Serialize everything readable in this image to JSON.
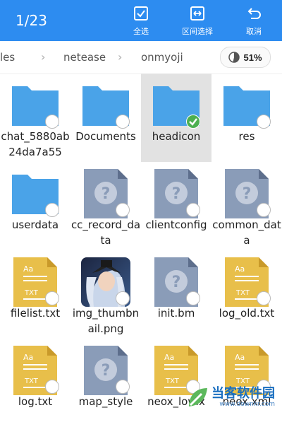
{
  "header": {
    "counter": "1/23",
    "actions": [
      {
        "label": "全选",
        "icon": "check-box-icon"
      },
      {
        "label": "区间选择",
        "icon": "range-select-icon"
      },
      {
        "label": "取消",
        "icon": "return-arrow-icon"
      }
    ],
    "background": "#2d8cf0"
  },
  "breadcrumb": {
    "items": [
      "les",
      "netease",
      "onmyoji"
    ],
    "storage": "51%"
  },
  "files": [
    {
      "name": "chat_5880ab24da7a55",
      "type": "folder",
      "selected": false
    },
    {
      "name": "Documents",
      "type": "folder",
      "selected": false
    },
    {
      "name": "headicon",
      "type": "folder",
      "selected": true
    },
    {
      "name": "res",
      "type": "folder",
      "selected": false
    },
    {
      "name": "userdata",
      "type": "folder",
      "selected": false
    },
    {
      "name": "cc_record_data",
      "type": "unknown",
      "selected": false
    },
    {
      "name": "clientconfig",
      "type": "unknown",
      "selected": false
    },
    {
      "name": "common_data",
      "type": "unknown",
      "selected": false
    },
    {
      "name": "filelist.txt",
      "type": "txt",
      "selected": false
    },
    {
      "name": "img_thumbnail.png",
      "type": "image",
      "selected": false
    },
    {
      "name": "init.bm",
      "type": "unknown",
      "selected": false
    },
    {
      "name": "log_old.txt",
      "type": "txt",
      "selected": false
    },
    {
      "name": "log.txt",
      "type": "txt",
      "selected": false
    },
    {
      "name": "map_style",
      "type": "unknown",
      "selected": false
    },
    {
      "name": "neox_low.x",
      "type": "txt",
      "selected": false
    },
    {
      "name": "neox.xml",
      "type": "txt",
      "selected": false
    }
  ],
  "watermark": {
    "text": "当客软件园",
    "url": "www.downkr.com"
  },
  "colors": {
    "folder": "#4aa3e8",
    "unknown": "#8a9cb8",
    "txt": "#e8bf4a",
    "check": "#4caf50"
  }
}
